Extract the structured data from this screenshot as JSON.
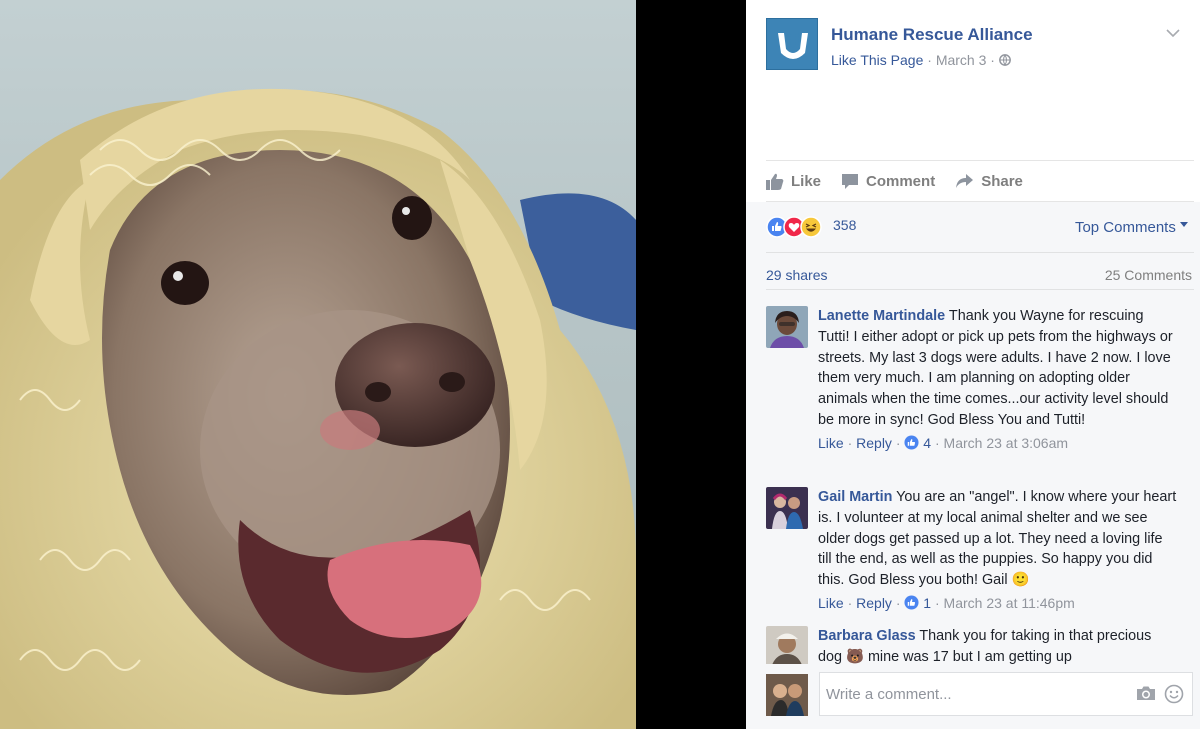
{
  "post": {
    "page_name": "Humane Rescue Alliance",
    "like_page_label": "Like This Page",
    "date": "March 3",
    "separator": "·",
    "globe_icon": "globe-icon"
  },
  "actions": {
    "like_label": "Like",
    "comment_label": "Comment",
    "share_label": "Share"
  },
  "reactions": {
    "icons": [
      "like-icon",
      "love-icon",
      "haha-icon"
    ],
    "count": "358",
    "sort_label": "Top Comments"
  },
  "stats": {
    "shares": "29 shares",
    "comments": "25 Comments"
  },
  "comments": [
    {
      "author": "Lanette Martindale",
      "text": "Thank you Wayne for rescuing Tutti! I either adopt or pick up pets from the highways or streets. My last 3 dogs were adults. I have 2 now. I love them very much. I am planning on adopting older animals when the time comes...our activity level should be more in sync! God Bless You and Tutti!",
      "like_label": "Like",
      "reply_label": "Reply",
      "likes": "4",
      "timestamp": "March 23 at 3:06am"
    },
    {
      "author": "Gail Martin",
      "text": "You are an \"angel\". I know where your heart is. I volunteer at my local animal shelter and we see older dogs get passed up a lot. They need a loving life till the end, as well as the puppies. So happy you did this. God Bless you both! Gail",
      "emoji": "🙂",
      "like_label": "Like",
      "reply_label": "Reply",
      "likes": "1",
      "timestamp": "March 23 at 11:46pm"
    },
    {
      "author": "Barbara Glass",
      "text_before_emoji": "Thank you for taking in that precious dog",
      "emoji": "🐻",
      "text_after_emoji": "mine was 17 but I am getting up"
    }
  ],
  "composer": {
    "placeholder": "Write a comment...",
    "camera_icon": "camera-icon",
    "smiley_icon": "smiley-icon"
  },
  "colors": {
    "link_blue": "#365899",
    "logo_blue": "#3d84b6",
    "meta_gray": "#90949c",
    "like_blue": "#4a84f0",
    "love_red": "#f0284a",
    "haha_yellow": "#f7c83b"
  }
}
